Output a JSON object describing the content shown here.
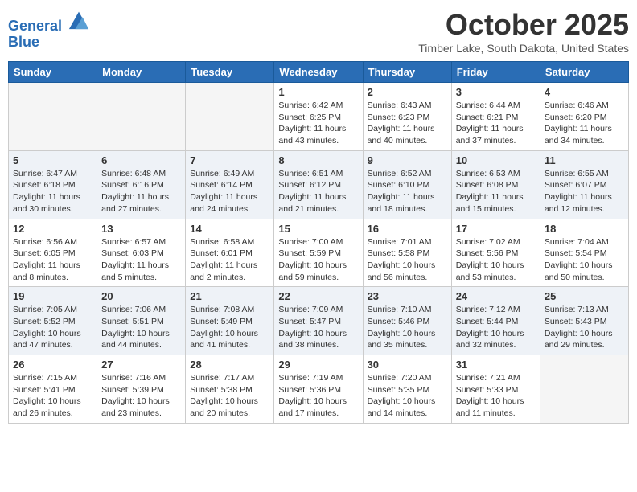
{
  "header": {
    "logo_line1": "General",
    "logo_line2": "Blue",
    "month_title": "October 2025",
    "location": "Timber Lake, South Dakota, United States"
  },
  "weekdays": [
    "Sunday",
    "Monday",
    "Tuesday",
    "Wednesday",
    "Thursday",
    "Friday",
    "Saturday"
  ],
  "weeks": [
    [
      {
        "day": "",
        "info": ""
      },
      {
        "day": "",
        "info": ""
      },
      {
        "day": "",
        "info": ""
      },
      {
        "day": "1",
        "info": "Sunrise: 6:42 AM\nSunset: 6:25 PM\nDaylight: 11 hours\nand 43 minutes."
      },
      {
        "day": "2",
        "info": "Sunrise: 6:43 AM\nSunset: 6:23 PM\nDaylight: 11 hours\nand 40 minutes."
      },
      {
        "day": "3",
        "info": "Sunrise: 6:44 AM\nSunset: 6:21 PM\nDaylight: 11 hours\nand 37 minutes."
      },
      {
        "day": "4",
        "info": "Sunrise: 6:46 AM\nSunset: 6:20 PM\nDaylight: 11 hours\nand 34 minutes."
      }
    ],
    [
      {
        "day": "5",
        "info": "Sunrise: 6:47 AM\nSunset: 6:18 PM\nDaylight: 11 hours\nand 30 minutes."
      },
      {
        "day": "6",
        "info": "Sunrise: 6:48 AM\nSunset: 6:16 PM\nDaylight: 11 hours\nand 27 minutes."
      },
      {
        "day": "7",
        "info": "Sunrise: 6:49 AM\nSunset: 6:14 PM\nDaylight: 11 hours\nand 24 minutes."
      },
      {
        "day": "8",
        "info": "Sunrise: 6:51 AM\nSunset: 6:12 PM\nDaylight: 11 hours\nand 21 minutes."
      },
      {
        "day": "9",
        "info": "Sunrise: 6:52 AM\nSunset: 6:10 PM\nDaylight: 11 hours\nand 18 minutes."
      },
      {
        "day": "10",
        "info": "Sunrise: 6:53 AM\nSunset: 6:08 PM\nDaylight: 11 hours\nand 15 minutes."
      },
      {
        "day": "11",
        "info": "Sunrise: 6:55 AM\nSunset: 6:07 PM\nDaylight: 11 hours\nand 12 minutes."
      }
    ],
    [
      {
        "day": "12",
        "info": "Sunrise: 6:56 AM\nSunset: 6:05 PM\nDaylight: 11 hours\nand 8 minutes."
      },
      {
        "day": "13",
        "info": "Sunrise: 6:57 AM\nSunset: 6:03 PM\nDaylight: 11 hours\nand 5 minutes."
      },
      {
        "day": "14",
        "info": "Sunrise: 6:58 AM\nSunset: 6:01 PM\nDaylight: 11 hours\nand 2 minutes."
      },
      {
        "day": "15",
        "info": "Sunrise: 7:00 AM\nSunset: 5:59 PM\nDaylight: 10 hours\nand 59 minutes."
      },
      {
        "day": "16",
        "info": "Sunrise: 7:01 AM\nSunset: 5:58 PM\nDaylight: 10 hours\nand 56 minutes."
      },
      {
        "day": "17",
        "info": "Sunrise: 7:02 AM\nSunset: 5:56 PM\nDaylight: 10 hours\nand 53 minutes."
      },
      {
        "day": "18",
        "info": "Sunrise: 7:04 AM\nSunset: 5:54 PM\nDaylight: 10 hours\nand 50 minutes."
      }
    ],
    [
      {
        "day": "19",
        "info": "Sunrise: 7:05 AM\nSunset: 5:52 PM\nDaylight: 10 hours\nand 47 minutes."
      },
      {
        "day": "20",
        "info": "Sunrise: 7:06 AM\nSunset: 5:51 PM\nDaylight: 10 hours\nand 44 minutes."
      },
      {
        "day": "21",
        "info": "Sunrise: 7:08 AM\nSunset: 5:49 PM\nDaylight: 10 hours\nand 41 minutes."
      },
      {
        "day": "22",
        "info": "Sunrise: 7:09 AM\nSunset: 5:47 PM\nDaylight: 10 hours\nand 38 minutes."
      },
      {
        "day": "23",
        "info": "Sunrise: 7:10 AM\nSunset: 5:46 PM\nDaylight: 10 hours\nand 35 minutes."
      },
      {
        "day": "24",
        "info": "Sunrise: 7:12 AM\nSunset: 5:44 PM\nDaylight: 10 hours\nand 32 minutes."
      },
      {
        "day": "25",
        "info": "Sunrise: 7:13 AM\nSunset: 5:43 PM\nDaylight: 10 hours\nand 29 minutes."
      }
    ],
    [
      {
        "day": "26",
        "info": "Sunrise: 7:15 AM\nSunset: 5:41 PM\nDaylight: 10 hours\nand 26 minutes."
      },
      {
        "day": "27",
        "info": "Sunrise: 7:16 AM\nSunset: 5:39 PM\nDaylight: 10 hours\nand 23 minutes."
      },
      {
        "day": "28",
        "info": "Sunrise: 7:17 AM\nSunset: 5:38 PM\nDaylight: 10 hours\nand 20 minutes."
      },
      {
        "day": "29",
        "info": "Sunrise: 7:19 AM\nSunset: 5:36 PM\nDaylight: 10 hours\nand 17 minutes."
      },
      {
        "day": "30",
        "info": "Sunrise: 7:20 AM\nSunset: 5:35 PM\nDaylight: 10 hours\nand 14 minutes."
      },
      {
        "day": "31",
        "info": "Sunrise: 7:21 AM\nSunset: 5:33 PM\nDaylight: 10 hours\nand 11 minutes."
      },
      {
        "day": "",
        "info": ""
      }
    ]
  ]
}
